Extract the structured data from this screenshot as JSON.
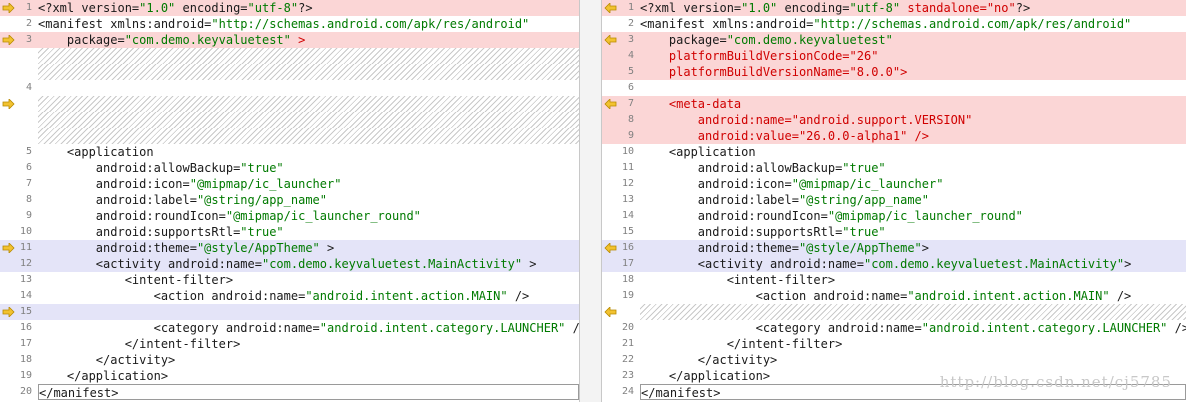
{
  "colors": {
    "changed_bg": "#fbd6d6",
    "moved_bg": "#e4e4f8",
    "string": "#007a00",
    "removed_added": "#d00000",
    "marker": "#e0a800"
  },
  "left": {
    "lines": [
      {
        "n": "1",
        "t": "<?xml version=\"1.0\" encoding=\"utf-8\"?>",
        "hl": "changed",
        "marker": "arrow"
      },
      {
        "n": "2",
        "t": "<manifest xmlns:android=\"http://schemas.android.com/apk/res/android\""
      },
      {
        "n": "3",
        "t": "    package=\"com.demo.keyvaluetest\" >",
        "hl": "changed",
        "marker": "arrow"
      },
      {
        "n": "",
        "t": "",
        "filler": true
      },
      {
        "n": "",
        "t": "",
        "filler": true
      },
      {
        "n": "4",
        "t": ""
      },
      {
        "n": "",
        "t": "",
        "filler": true,
        "marker": "arrow"
      },
      {
        "n": "",
        "t": "",
        "filler": true
      },
      {
        "n": "",
        "t": "",
        "filler": true
      },
      {
        "n": "5",
        "t": "    <application"
      },
      {
        "n": "6",
        "t": "        android:allowBackup=\"true\""
      },
      {
        "n": "7",
        "t": "        android:icon=\"@mipmap/ic_launcher\""
      },
      {
        "n": "8",
        "t": "        android:label=\"@string/app_name\""
      },
      {
        "n": "9",
        "t": "        android:roundIcon=\"@mipmap/ic_launcher_round\""
      },
      {
        "n": "10",
        "t": "        android:supportsRtl=\"true\""
      },
      {
        "n": "11",
        "t": "        android:theme=\"@style/AppTheme\" >",
        "hl": "moved",
        "marker": "arrow"
      },
      {
        "n": "12",
        "t": "        <activity android:name=\"com.demo.keyvaluetest.MainActivity\" >",
        "hl": "moved"
      },
      {
        "n": "13",
        "t": "            <intent-filter>"
      },
      {
        "n": "14",
        "t": "                <action android:name=\"android.intent.action.MAIN\" />"
      },
      {
        "n": "15",
        "t": "",
        "hl": "moved",
        "marker": "arrow"
      },
      {
        "n": "16",
        "t": "                <category android:name=\"android.intent.category.LAUNCHER\" />"
      },
      {
        "n": "17",
        "t": "            </intent-filter>"
      },
      {
        "n": "18",
        "t": "        </activity>"
      },
      {
        "n": "19",
        "t": "    </application>"
      },
      {
        "n": "20",
        "t": "</manifest>",
        "last": true
      }
    ]
  },
  "right": {
    "lines": [
      {
        "n": "1",
        "t": "<?xml version=\"1.0\" encoding=\"utf-8\" standalone=\"no\"?>",
        "hl": "changed",
        "marker": "arrowleft"
      },
      {
        "n": "2",
        "t": "<manifest xmlns:android=\"http://schemas.android.com/apk/res/android\""
      },
      {
        "n": "3",
        "t": "    package=\"com.demo.keyvaluetest\"",
        "hl": "changed",
        "marker": "arrowleft"
      },
      {
        "n": "4",
        "t": "    platformBuildVersionCode=\"26\"",
        "hl": "changed"
      },
      {
        "n": "5",
        "t": "    platformBuildVersionName=\"8.0.0\">",
        "hl": "changed"
      },
      {
        "n": "6",
        "t": ""
      },
      {
        "n": "7",
        "t": "    <meta-data",
        "hl": "changed",
        "marker": "arrowleft"
      },
      {
        "n": "8",
        "t": "        android:name=\"android.support.VERSION\"",
        "hl": "changed"
      },
      {
        "n": "9",
        "t": "        android:value=\"26.0.0-alpha1\" />",
        "hl": "changed"
      },
      {
        "n": "10",
        "t": "    <application"
      },
      {
        "n": "11",
        "t": "        android:allowBackup=\"true\""
      },
      {
        "n": "12",
        "t": "        android:icon=\"@mipmap/ic_launcher\""
      },
      {
        "n": "13",
        "t": "        android:label=\"@string/app_name\""
      },
      {
        "n": "14",
        "t": "        android:roundIcon=\"@mipmap/ic_launcher_round\""
      },
      {
        "n": "15",
        "t": "        android:supportsRtl=\"true\""
      },
      {
        "n": "16",
        "t": "        android:theme=\"@style/AppTheme\">",
        "hl": "moved",
        "marker": "arrowleft"
      },
      {
        "n": "17",
        "t": "        <activity android:name=\"com.demo.keyvaluetest.MainActivity\">",
        "hl": "moved"
      },
      {
        "n": "18",
        "t": "            <intent-filter>"
      },
      {
        "n": "19",
        "t": "                <action android:name=\"android.intent.action.MAIN\" />"
      },
      {
        "n": "",
        "t": "",
        "filler": true,
        "marker": "arrowleft"
      },
      {
        "n": "20",
        "t": "                <category android:name=\"android.intent.category.LAUNCHER\" />"
      },
      {
        "n": "21",
        "t": "            </intent-filter>"
      },
      {
        "n": "22",
        "t": "        </activity>"
      },
      {
        "n": "23",
        "t": "    </application>"
      },
      {
        "n": "24",
        "t": "</manifest>",
        "last": true
      }
    ]
  },
  "watermark": "http://blog.csdn.net/cj5785"
}
